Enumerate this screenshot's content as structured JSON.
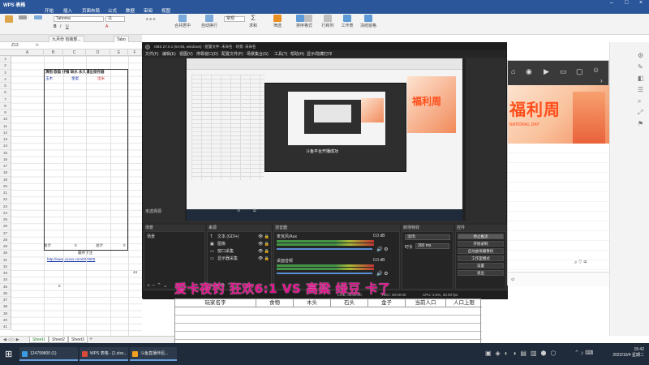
{
  "wps": {
    "app_title": "WPS 表格",
    "menu": [
      "开始",
      "插入",
      "页面布局",
      "公式",
      "数据",
      "审阅",
      "视图"
    ],
    "ribbon": {
      "font_name": "Tahoma",
      "font_size": "11",
      "buttons": [
        "合并居中",
        "自动换行",
        "常规",
        "求和",
        "筛选",
        "排序",
        "格式",
        "行和列",
        "工作表",
        "冻结窗格"
      ]
    },
    "doc_tabs": [
      "九月份 包装部...",
      "Tabo"
    ],
    "cell_ref": "Z13",
    "columns": [
      "A",
      "B",
      "C",
      "D",
      "E",
      "F"
    ],
    "rows": [
      "1",
      "2",
      "3",
      "4",
      "5",
      "6",
      "7",
      "8",
      "9",
      "10",
      "11",
      "12",
      "13",
      "14",
      "15",
      "16",
      "17",
      "18",
      "19",
      "20",
      "21",
      "22",
      "23",
      "24",
      "25",
      "26",
      "27",
      "28",
      "29",
      "30",
      "31",
      "32",
      "33",
      "34",
      "35",
      "36",
      "37",
      "38",
      "39",
      "40",
      "41"
    ],
    "cells": {
      "header_row": "清租 欧盈 养殖 缺水 永久爆出保存器",
      "label_a": "玉木",
      "label_b": "金蛋",
      "label_c": "出米",
      "total_label_1": "总计",
      "total_val_1": "0",
      "total_label_2": "总计",
      "total_val_2": "0",
      "note_label": "最终下注",
      "url": "http://www.xxxxx.com/000000",
      "num_44": "44",
      "num_0": "0"
    },
    "sheet_tabs": [
      "Sheet1",
      "Sheet2",
      "Sheet3"
    ]
  },
  "obs": {
    "title": "OBS 27.0.1 (64-bit, windows) - 配置文件: 未命名 - 场景: 未命名",
    "menu": [
      "文件(F)",
      "编辑(E)",
      "视图(V)",
      "停靠窗口(D)",
      "配置文件(P)",
      "场景集合(S)",
      "工具(T)",
      "帮助(H)",
      "显示/隐藏打印"
    ],
    "no_source_label": "未选择源",
    "dock_headers": [
      "场景",
      "来源",
      "混音器",
      "转场特效",
      "控件"
    ],
    "scene_item": "场景",
    "sources": [
      "文本 (GDI+)",
      "图像",
      "窗口采集",
      "显示器采集"
    ],
    "mixer_tracks": [
      {
        "name": "麦克风/Aux",
        "db": "0.0 dB"
      },
      {
        "name": "桌面音频",
        "db": "0.0 dB"
      }
    ],
    "transition": {
      "type": "淡出",
      "duration_label": "时长",
      "duration": "300 ms"
    },
    "controls": [
      "停止推流",
      "开始录制",
      "启动虚拟摄像机",
      "工作室模式",
      "设置",
      "退出"
    ],
    "status": [
      "LIVE: 00:00:00",
      "REC: 00:00:00",
      "CPU: 3.5%, 30.00 fps"
    ],
    "preview_caption": "斗鱼平台开播成功"
  },
  "web": {
    "banner_title": "福利周",
    "banner_sub": "NATIONAL DAY"
  },
  "overlay": {
    "text": "爱卡夜钓 狂欢6:1 VS 高粱 绿豆 卡了"
  },
  "bottom_table": {
    "headers": [
      "玩家名字",
      "食物",
      "木头",
      "石头",
      "金子",
      "当前人口",
      "人口上限"
    ]
  },
  "taskbar": {
    "items": [
      "124799800 (1)",
      "WPS 表格 - [1.xlsx...",
      "斗鱼直播伴侣..."
    ],
    "clock_time": "15:42",
    "clock_date": "2022/10/4 星期二"
  },
  "colors": {
    "wps_blue": "#2b579a",
    "overlay_magenta": "#e0118c",
    "banner_orange": "#ff4d1a"
  }
}
